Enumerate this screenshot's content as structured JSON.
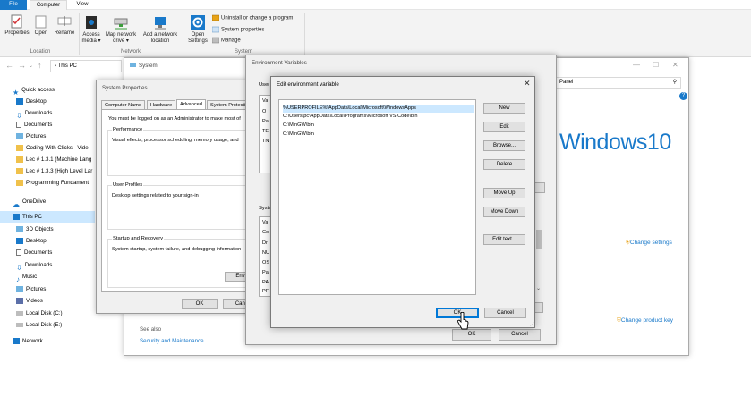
{
  "ribbon": {
    "tabs": [
      "File",
      "Computer",
      "View"
    ],
    "properties": "Properties",
    "open": "Open",
    "rename": "Rename",
    "group_location": "Location",
    "access_media_1": "Access",
    "access_media_2": "media ▾",
    "map_drive_1": "Map network",
    "map_drive_2": "drive ▾",
    "add_location_1": "Add a network",
    "add_location_2": "location",
    "group_network": "Network",
    "open_settings_1": "Open",
    "open_settings_2": "Settings",
    "uninstall": "Uninstall or change a program",
    "system_properties": "System properties",
    "manage": "Manage",
    "group_system": "System"
  },
  "address": {
    "path": "› This PC"
  },
  "nav": {
    "quick_access": "Quick access",
    "desktop": "Desktop",
    "downloads": "Downloads",
    "documents": "Documents",
    "pictures": "Pictures",
    "coding": "Coding With Clicks - Vide",
    "lec1": "Lec # 1.3.1 (Machine Lang",
    "lec2": "Lec # 1.3.3 (High Level Lar",
    "programming": "Programming Fundament",
    "onedrive": "OneDrive",
    "thispc": "This PC",
    "objects3d": "3D Objects",
    "desktop2": "Desktop",
    "documents2": "Documents",
    "downloads2": "Downloads",
    "music": "Music",
    "pictures2": "Pictures",
    "videos": "Videos",
    "local_c": "Local Disk (C:)",
    "local_e": "Local Disk (E:)",
    "network": "Network"
  },
  "system_window": {
    "title": "System",
    "search_hint": "Panel",
    "windows10": "Windows10",
    "change_settings": "Change settings",
    "change_key": "Change product key",
    "see_also": "See also",
    "security": "Security and Maintenance"
  },
  "sysprops": {
    "title": "System Properties",
    "tabs": [
      "Computer Name",
      "Hardware",
      "Advanced",
      "System Protection"
    ],
    "admin_note": "You must be logged on as an Administrator to make most of",
    "perf_legend": "Performance",
    "perf_text": "Visual effects, processor scheduling, memory usage, and",
    "profiles_legend": "User Profiles",
    "profiles_text": "Desktop settings related to your sign-in",
    "startup_legend": "Startup and Recovery",
    "startup_text": "System startup, system failure, and debugging information",
    "env_button": "Environ",
    "ok": "OK",
    "cancel": "Cance"
  },
  "envvars": {
    "title": "Environment Variables",
    "user_label": "User",
    "sys_label": "Syste",
    "user_col": [
      "Va",
      "O",
      "Pa",
      "TE",
      "TN"
    ],
    "sys_col": [
      "Va",
      "Co",
      "Dr",
      "NU",
      "OS",
      "Pa",
      "PA",
      "PF"
    ],
    "ok": "OK",
    "cancel": "Cancel"
  },
  "editvar": {
    "title": "Edit environment variable",
    "close": "✕",
    "entries": [
      "%USERPROFILE%\\AppData\\Local\\Microsoft\\WindowsApps",
      "C:\\Users\\pc\\AppData\\Local\\Programs\\Microsoft VS Code\\bin",
      "C:\\MinGW\\bin",
      "C:\\MinGW\\bin"
    ],
    "buttons": {
      "new": "New",
      "edit": "Edit",
      "browse": "Browse...",
      "delete": "Delete",
      "move_up": "Move Up",
      "move_down": "Move Down",
      "edit_text": "Edit text..."
    },
    "ok": "OK",
    "cancel": "Cancel"
  }
}
